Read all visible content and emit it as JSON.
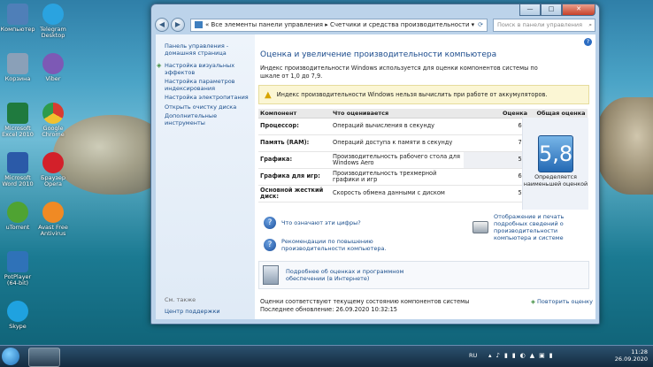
{
  "desktop": {
    "icons": [
      {
        "label": "Компьютер",
        "color": "#4f7fb8"
      },
      {
        "label": "Telegram Desktop",
        "color": "#2aa3e0"
      },
      {
        "label": "Корзина",
        "color": "#8aa0b8"
      },
      {
        "label": "Viber",
        "color": "#7d59b5"
      },
      {
        "label": "Microsoft Excel 2010",
        "color": "#1f7a3e"
      },
      {
        "label": "Google Chrome",
        "color": "#e5a92b"
      },
      {
        "label": "Microsoft Word 2010",
        "color": "#2b5aa8"
      },
      {
        "label": "Браузер Opera",
        "color": "#d3202a"
      },
      {
        "label": "uTorrent",
        "color": "#4fa332"
      },
      {
        "label": "Avast Free Antivirus",
        "color": "#f08a24"
      },
      {
        "label": "PotPlayer (64-bit)",
        "color": "#2f72b8"
      },
      {
        "label": "Skype",
        "color": "#1fa2e0"
      }
    ]
  },
  "window": {
    "breadcrumb": [
      "Все элементы панели управления",
      "Счетчики и средства производительности"
    ],
    "search_placeholder": "Поиск в панели управления",
    "buttons": {
      "minimize": "—",
      "maximize": "□",
      "close": "✕"
    }
  },
  "sidebar": {
    "home": "Панель управления - домашняя страница",
    "links": [
      "Настройка визуальных эффектов",
      "Настройка параметров индексирования",
      "Настройка электропитания",
      "Открыть очистку диска",
      "Дополнительные инструменты"
    ],
    "see_also": "См. также",
    "support": "Центр поддержки"
  },
  "main": {
    "title": "Оценка и увеличение производительности компьютера",
    "description": "Индекс производительности Windows используется для оценки компонентов системы по шкале от 1,0 до 7,9.",
    "warning": "Индекс производительности Windows нельзя вычислить при работе от аккумуляторов.",
    "table_headers": {
      "component": "Компонент",
      "what": "Что оценивается",
      "score": "Оценка",
      "base": "Общая оценка"
    },
    "rows": [
      {
        "component": "Процессор:",
        "what": "Операций вычисления в секунду",
        "score": "6,8"
      },
      {
        "component": "Память (RAM):",
        "what": "Операций доступа к памяти в секунду",
        "score": "7,3"
      },
      {
        "component": "Графика:",
        "what": "Производительность рабочего стола для Windows Aero",
        "score": "5,8"
      },
      {
        "component": "Графика для игр:",
        "what": "Производительность трехмерной графики и игр",
        "score": "6,5"
      },
      {
        "component": "Основной жесткий диск:",
        "what": "Скорость обмена данными с диском",
        "score": "5,9"
      }
    ],
    "base_score": "5,8",
    "base_caption": "Определяется наименьшей оценкой",
    "links": {
      "what_numbers": "Что означают эти цифры?",
      "tips": "Рекомендации по повышению производительности компьютера.",
      "print": "Отображение и печать подробных сведений о производительности компьютера и системе",
      "online": "Подробнее об оценках и программном обеспечении (в Интернете)",
      "rerun": "Повторить оценку"
    },
    "footer": {
      "status": "Оценки соответствуют текущему состоянию компонентов системы",
      "updated": "Последнее обновление: 26.09.2020 10:32:15"
    }
  },
  "taskbar": {
    "lang": "RU",
    "time": "11:28",
    "date": "26.09.2020"
  }
}
